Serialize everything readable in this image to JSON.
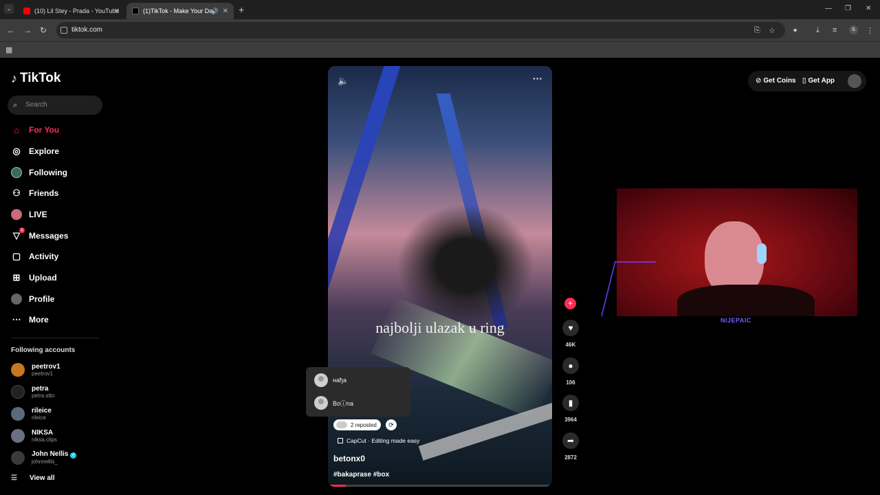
{
  "browser": {
    "tabs": [
      {
        "title": "(10) Lil Stey - Prada - YouTube",
        "favicon_color": "#ff0000"
      },
      {
        "title": "(1)TikTok - Make Your Day",
        "favicon_color": "#000000"
      }
    ],
    "url": "tiktok.com",
    "profile_initial": "S"
  },
  "sidebar": {
    "logo": "TikTok",
    "search_placeholder": "Search",
    "nav": [
      {
        "label": "For You",
        "icon": "home-icon"
      },
      {
        "label": "Explore",
        "icon": "compass-icon"
      },
      {
        "label": "Following",
        "icon": "following-avatar-icon"
      },
      {
        "label": "Friends",
        "icon": "friends-icon"
      },
      {
        "label": "LIVE",
        "icon": "live-icon"
      },
      {
        "label": "Messages",
        "icon": "messages-icon",
        "badge": "1"
      },
      {
        "label": "Activity",
        "icon": "activity-icon"
      },
      {
        "label": "Upload",
        "icon": "upload-icon"
      },
      {
        "label": "Profile",
        "icon": "profile-icon"
      },
      {
        "label": "More",
        "icon": "more-icon"
      }
    ],
    "following_title": "Following accounts",
    "accounts": [
      {
        "name": "peetrov1",
        "handle": "peetrov1"
      },
      {
        "name": "petra",
        "handle": "petra.stto"
      },
      {
        "name": "rileice",
        "handle": "rileice"
      },
      {
        "name": "NIKSA",
        "handle": "niksa.clips"
      },
      {
        "name": "John Nellis",
        "handle": "johnnellis_",
        "verified": true
      }
    ],
    "view_all": "View all"
  },
  "video": {
    "caption_overlay": "najbolji ulazak u ring",
    "reposted_label": "2 reposted",
    "capcut_label": "CapCut · Editing made easy",
    "author": "betonx0",
    "tags": "#bakaprase #box",
    "progress": 0.08
  },
  "repost_popup": {
    "users": [
      "нађа",
      "Boⓘna"
    ]
  },
  "actions": {
    "likes": "46K",
    "comments": "106",
    "saves": "3964",
    "shares": "2872"
  },
  "header_buttons": {
    "get_coins": "Get Coins",
    "get_app": "Get App"
  },
  "webcam": {
    "label": "NIJEPAIC"
  },
  "colors": {
    "accent": "#fe2c55",
    "background": "#000000"
  }
}
